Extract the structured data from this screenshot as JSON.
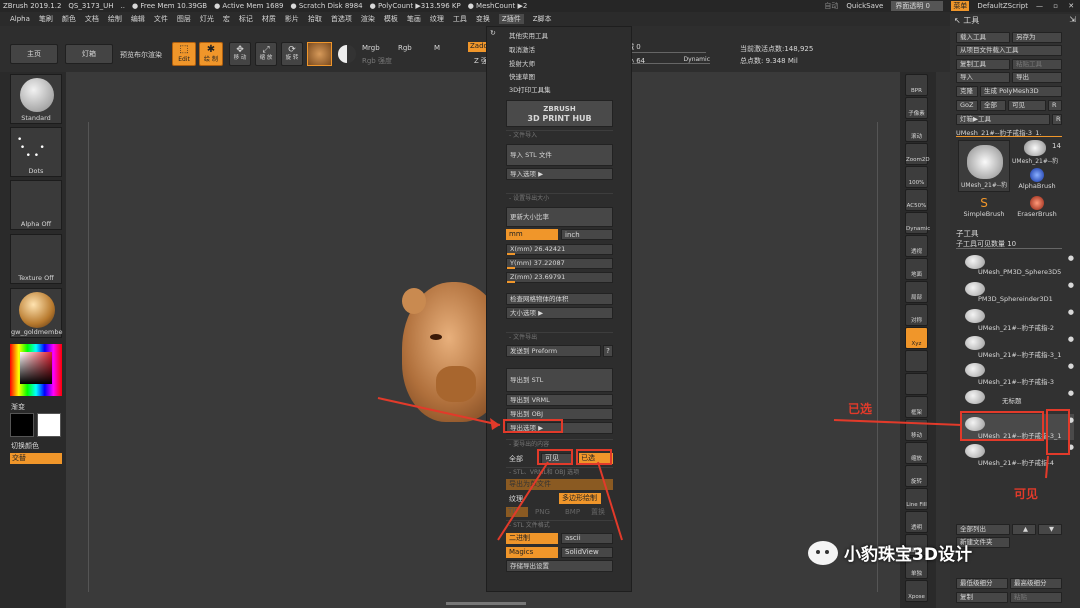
{
  "titlebar": {
    "app": "ZBrush 2019.1.2",
    "project": "QS_3173_UH",
    "ellipsis": "..",
    "free_mem": "● Free Mem 10.39GB",
    "active_mem": "● Active Mem 1689",
    "scratch": "● Scratch Disk 8984",
    "poly": "● PolyCount ▶313.596 KP",
    "mesh": "● MeshCount ▶2",
    "auto": "自动",
    "quicksave": "QuickSave",
    "transparency": "界面透明 0",
    "menu_btn": "菜单",
    "script": "DefaultZScript"
  },
  "menubar": [
    "Alpha",
    "笔刷",
    "颜色",
    "文档",
    "绘制",
    "编辑",
    "文件",
    "图层",
    "灯光",
    "宏",
    "标记",
    "材质",
    "影片",
    "拾取",
    "首选项",
    "渲染",
    "模板",
    "笔画",
    "纹理",
    "工具",
    "变换",
    "Z插件",
    "Z脚本"
  ],
  "toolbar": {
    "home": "主页",
    "lightbox": "灯箱",
    "preview": "预览布尔渲染",
    "edit": "Edit",
    "draw": "绘 制",
    "move": "移 动",
    "scale": "缩 放",
    "rotate": "旋 转",
    "mrgb": "Mrgb",
    "rgb": "Rgb",
    "m": "M",
    "zadd": "Zadd",
    "zsub": "Zsub",
    "rgb_intensity": "Rgb 强度",
    "z_intensity": "Z 强度 25",
    "focal_shift": "焦点衰减 0",
    "draw_size": "绘制大小 64",
    "dynamic": "Dynamic",
    "active_points": "当前激活点数:148,925",
    "total_points": "总点数: 9.348 Mil"
  },
  "leftshelf": {
    "standard": "Standard",
    "dots": "Dots",
    "alpha_off": "Alpha Off",
    "texture_off": "Texture Off",
    "material": "gw_goldmembe",
    "gradient": "渐变",
    "switch_color": "切换颜色",
    "alternate": "交替"
  },
  "dropdown": {
    "items": [
      "其他实用工具",
      "取消激活",
      "投射大师",
      "快速草图",
      "3D打印工具集"
    ],
    "hub_line1": "ZBRUSH",
    "hub_line2": "3D PRINT HUB",
    "file_import_head": "- 文件导入",
    "import_stl": "导入 STL 文件",
    "import_options": "导入选项 ▶",
    "set_size_head": "- 设置导出大小",
    "update_ratio": "更新大小比率",
    "mm": "mm",
    "inch": "inch",
    "x": "X(mm) 26.42421",
    "y": "Y(mm) 37.22087",
    "z": "Z(mm) 23.69791",
    "check_volume": "检查网格物体的体积",
    "size_options": "大小选项 ▶",
    "file_export_head": "- 文件导出",
    "send_preform": "发送到 Preform",
    "q": "?",
    "export_stl": "导出到 STL",
    "export_vrml": "导出到 VRML",
    "export_obj": "导出到 OBJ",
    "export_options": "导出选项 ▶",
    "export_content_head": "- 要导出的内容",
    "all": "全部",
    "visible": "可见",
    "selected": "已选",
    "stl_vrml_obj_head": "- STL、VRML和 OBJ 选项",
    "export_as_file": "导出为单文件",
    "texture": "纹理",
    "poly_paint": "多边形绘制",
    "tif": "TIF",
    "png": "PNG",
    "bmp": "BMP",
    "displace": "置换",
    "stl_format_head": "- STL 文件格式",
    "binary": "二进制",
    "ascii": "ascii",
    "magics": "Magics",
    "solidview": "SolidView",
    "save_settings": "存储导出设置"
  },
  "rightshelf": [
    "BPR",
    "子像素",
    "滚动",
    "Zoom2D",
    "100%",
    "AC50%",
    "Dynamic",
    "透视",
    "地面",
    "局部",
    "对称",
    "Xyz",
    "",
    "",
    "框架",
    "移动",
    "缩放",
    "旋转",
    "Line Fill",
    "透明",
    "幽灵",
    "单独",
    "Xpose"
  ],
  "toolpanel": {
    "title": "工具",
    "load": "载入工具",
    "save_as": "另存为",
    "load_from_project": "从项目文件载入工具",
    "copy": "复制工具",
    "paste": "粘贴工具",
    "import": "导入",
    "export": "导出",
    "clone": "克隆",
    "make_polymesh": "生成 PolyMesh3D",
    "goz": "GoZ",
    "all": "全部",
    "visible": "可见",
    "r": "R",
    "lightbox_tools": "灯箱▶工具",
    "current_tool": "UMesh_21#--豹子戒指-3_1.",
    "thumb_count": "14",
    "thumb_a": "UMesh_21#--豹",
    "thumb_b": "UMesh_21#--豹",
    "alphabrush": "AlphaBrush",
    "simplebrush": "SimpleBrush",
    "eraserbrush": "EraserBrush",
    "subtool_head": "子工具",
    "visible_count": "子工具可见数量 10",
    "subtools": [
      "UMesh_PM3D_Sphere3D5",
      "PM3D_Sphereinder3D1",
      "UMesh_21#--豹子戒指-2",
      "UMesh_21#--豹子戒指-3_1",
      "UMesh_21#--豹子戒指-3",
      "无标题",
      "UMesh_21#--豹子戒指-3_1",
      "UMesh_21#--豹子戒指-4"
    ],
    "list_all": "全部列出",
    "new_folder": "新建文件夹",
    "lowest_sub": "最低级细分",
    "highest_sub": "最高级细分",
    "dup": "复制",
    "paste2": "粘贴"
  },
  "annotations": {
    "selected": "已选",
    "visible": "可见",
    "watermark": "小豹珠宝3D设计"
  },
  "colors": {
    "accent": "#f0962a",
    "annotation": "#e23a2a",
    "bg": "#333333"
  }
}
